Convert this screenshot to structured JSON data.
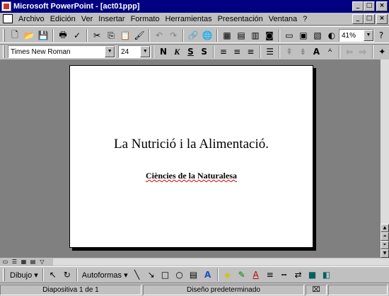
{
  "window": {
    "title": "Microsoft PowerPoint - [act01ppp]",
    "controls": [
      "_",
      "□",
      "×"
    ]
  },
  "menubar": {
    "items": [
      "Archivo",
      "Edición",
      "Ver",
      "Insertar",
      "Formato",
      "Herramientas",
      "Presentación",
      "Ventana",
      "?"
    ]
  },
  "standard_toolbar": {
    "zoom": "41%"
  },
  "format_toolbar": {
    "font": "Times New Roman",
    "size": "24",
    "bold": "N",
    "italic": "K",
    "underline": "S",
    "shadow": "S"
  },
  "slide": {
    "title": "La Nutrició i la Alimentació.",
    "subtitle": "Ciències de la Naturalesa"
  },
  "drawing_toolbar": {
    "draw_label": "Dibujo",
    "autoshapes_label": "Autoformas"
  },
  "statusbar": {
    "slide_info": "Diapositiva 1 de 1",
    "design": "Diseño predeterminado"
  },
  "colors": {
    "titlebar": "#000080",
    "workspace": "#808080",
    "chrome": "#c0c0c0"
  }
}
